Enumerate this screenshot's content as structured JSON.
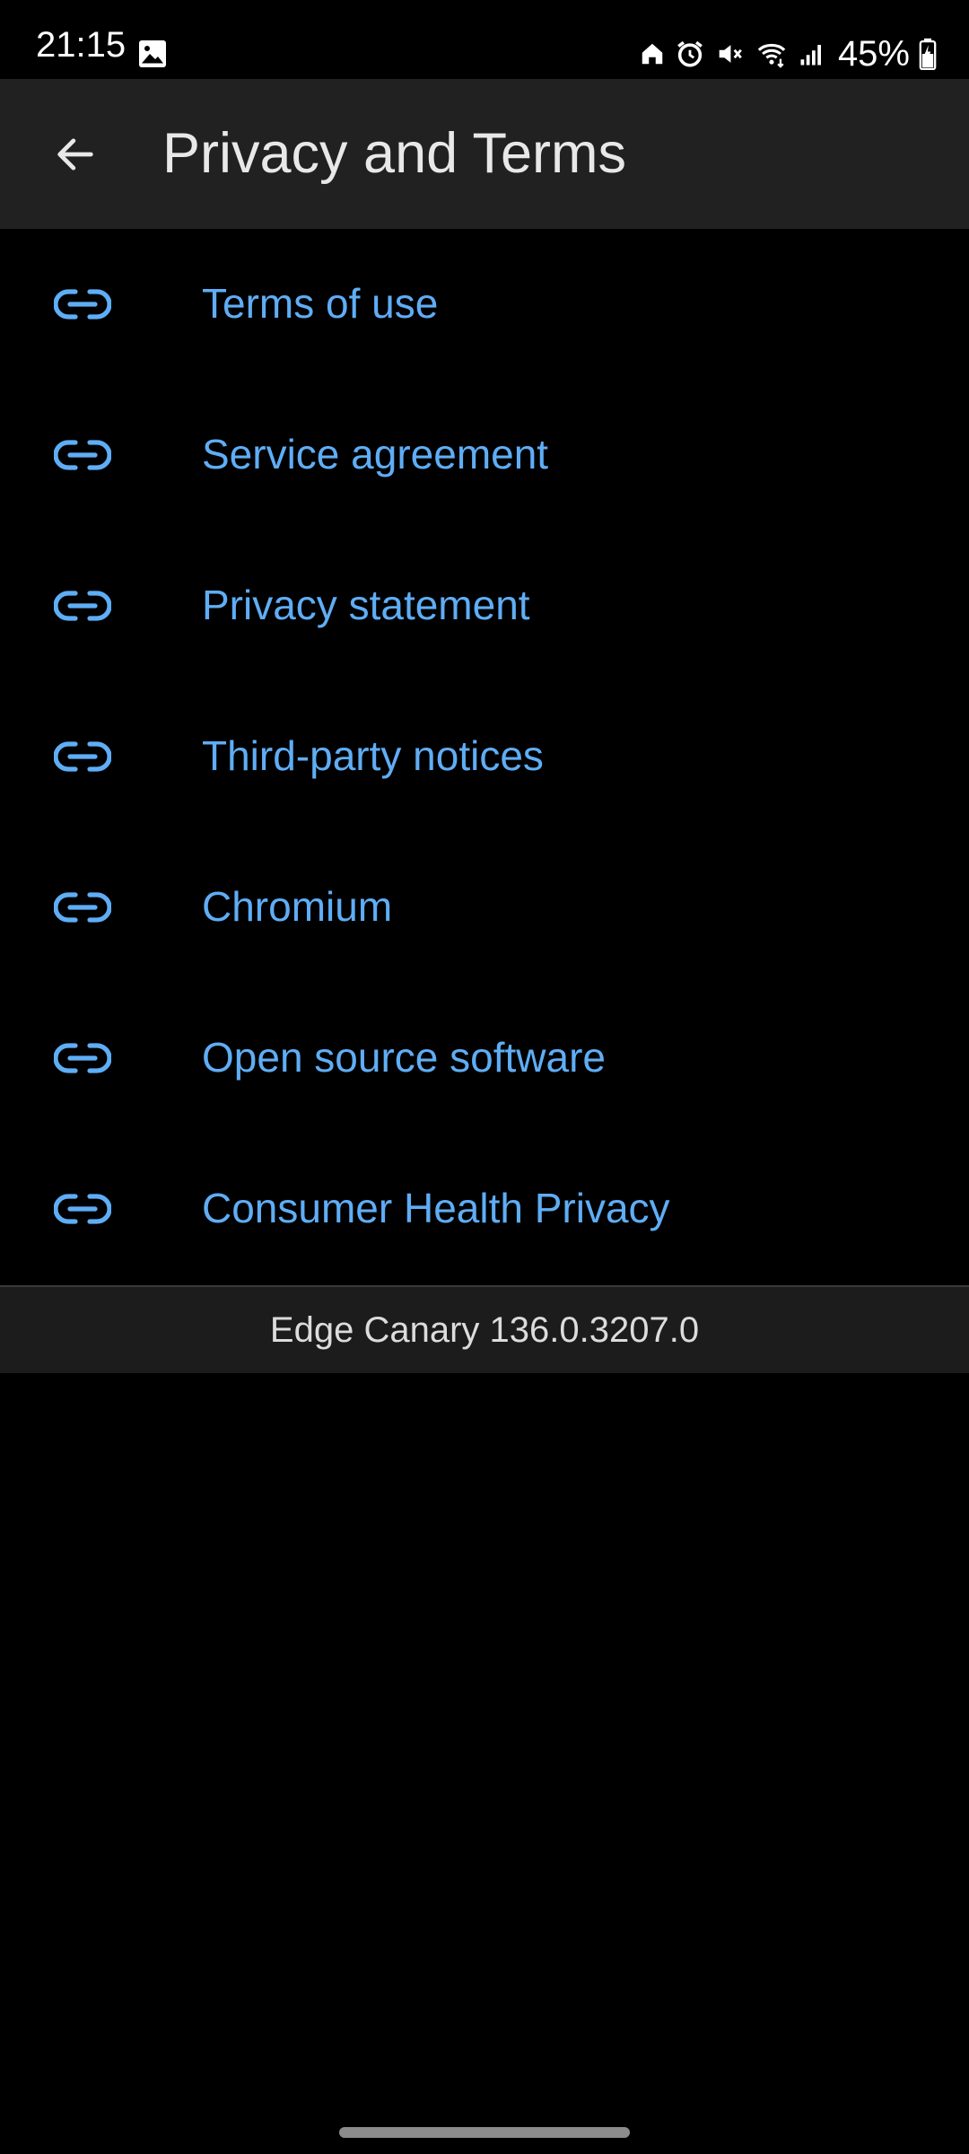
{
  "status_bar": {
    "time": "21:15",
    "battery": "45%",
    "icons": [
      "image-icon",
      "home-icon",
      "alarm-icon",
      "mute-icon",
      "wifi-icon",
      "signal-icon",
      "battery-icon"
    ]
  },
  "app_bar": {
    "title": "Privacy and Terms",
    "back_icon": "arrow-left-icon"
  },
  "links": [
    {
      "label": "Terms of use",
      "icon": "link-icon"
    },
    {
      "label": "Service agreement",
      "icon": "link-icon"
    },
    {
      "label": "Privacy statement",
      "icon": "link-icon"
    },
    {
      "label": "Third-party notices",
      "icon": "link-icon"
    },
    {
      "label": "Chromium",
      "icon": "link-icon"
    },
    {
      "label": "Open source software",
      "icon": "link-icon"
    },
    {
      "label": "Consumer Health Privacy",
      "icon": "link-icon"
    }
  ],
  "footer": {
    "version": "Edge Canary 136.0.3207.0"
  },
  "colors": {
    "background": "#000000",
    "app_bar": "#212121",
    "link": "#5fadf5",
    "footer": "#1c1c1c"
  }
}
